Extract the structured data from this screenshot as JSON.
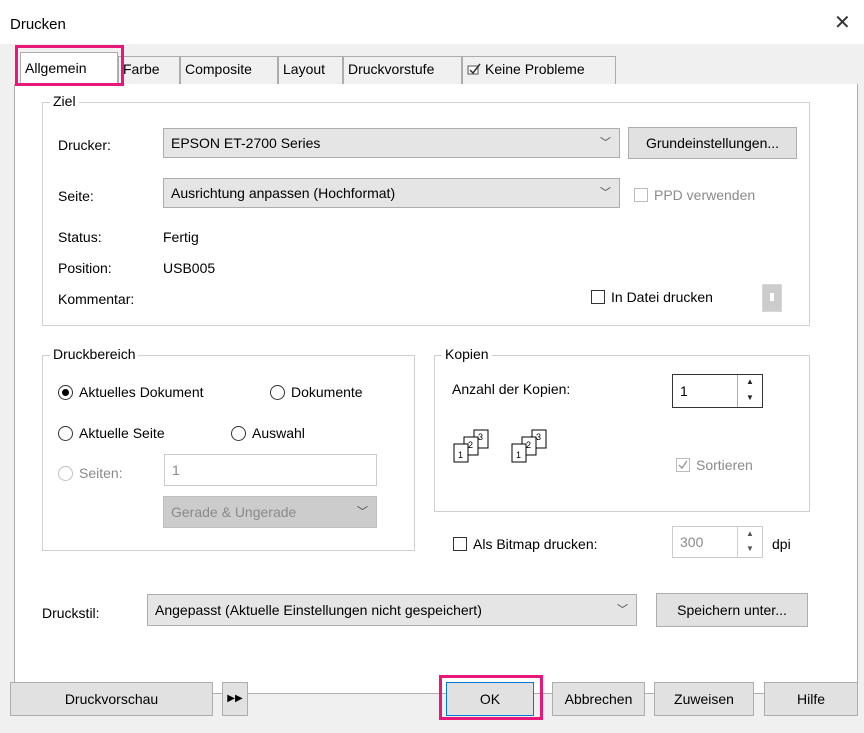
{
  "window": {
    "title": "Drucken",
    "close": "✕"
  },
  "tabs": [
    {
      "label": "Allgemein"
    },
    {
      "label": "Farbe"
    },
    {
      "label": "Composite"
    },
    {
      "label": "Layout"
    },
    {
      "label": "Druckvorstufe"
    },
    {
      "label": "Keine Probleme"
    }
  ],
  "ziel": {
    "legend": "Ziel",
    "drucker_label": "Drucker:",
    "drucker_value": "EPSON ET-2700 Series",
    "grundeinstellungen": "Grundeinstellungen...",
    "seite_label": "Seite:",
    "seite_value": "Ausrichtung anpassen (Hochformat)",
    "ppd_label": "PPD verwenden",
    "status_label": "Status:",
    "status_value": "Fertig",
    "position_label": "Position:",
    "position_value": "USB005",
    "kommentar_label": "Kommentar:",
    "in_datei_label": "In Datei drucken"
  },
  "druckbereich": {
    "legend": "Druckbereich",
    "aktuelles_dokument": "Aktuelles Dokument",
    "dokumente": "Dokumente",
    "aktuelle_seite": "Aktuelle Seite",
    "auswahl": "Auswahl",
    "seiten": "Seiten:",
    "seiten_value": "1",
    "gerade_ungerade": "Gerade & Ungerade"
  },
  "kopien": {
    "legend": "Kopien",
    "anzahl_label": "Anzahl der Kopien:",
    "anzahl_value": "1",
    "sortieren": "Sortieren",
    "page_numbers": [
      "1",
      "2",
      "3"
    ]
  },
  "bitmap": {
    "label": "Als Bitmap drucken:",
    "dpi_value": "300",
    "dpi_unit": "dpi"
  },
  "druckstil": {
    "label": "Druckstil:",
    "value": "Angepasst (Aktuelle Einstellungen nicht gespeichert)",
    "speichern": "Speichern unter..."
  },
  "footer": {
    "druckvorschau": "Druckvorschau",
    "ok": "OK",
    "abbrechen": "Abbrechen",
    "zuweisen": "Zuweisen",
    "hilfe": "Hilfe"
  },
  "colors": {
    "highlight": "#e8187a",
    "focus_border": "#0078d7"
  }
}
